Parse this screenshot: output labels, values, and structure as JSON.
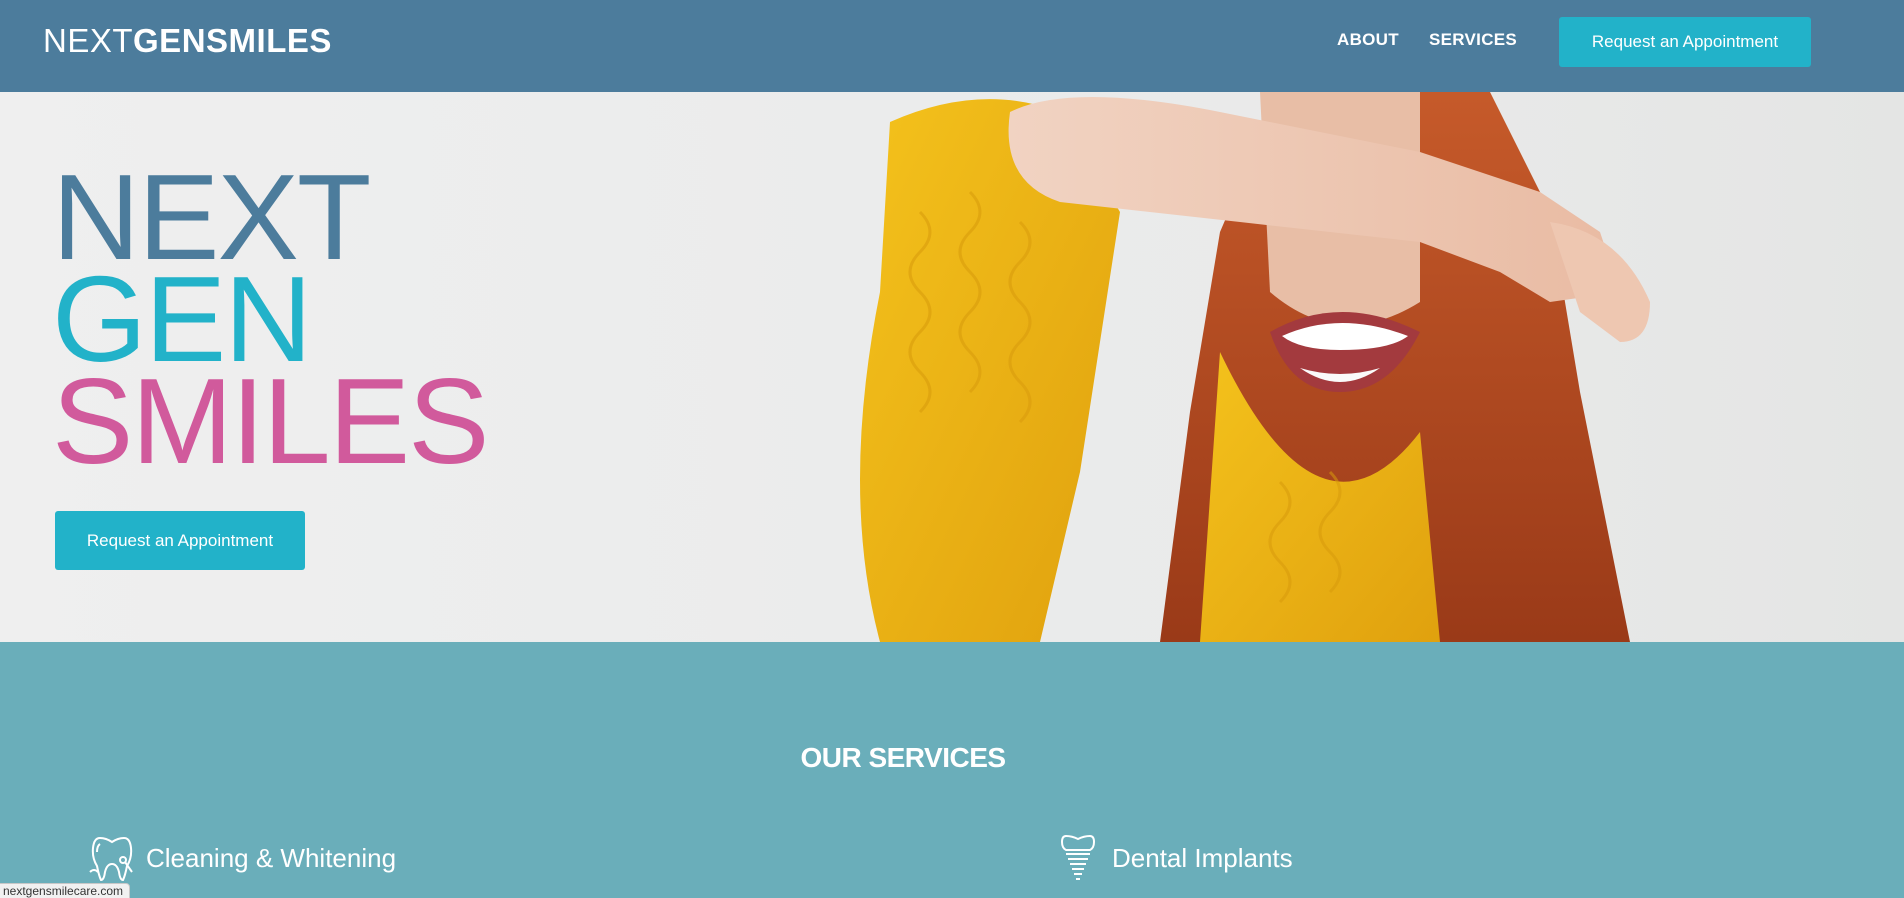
{
  "header": {
    "logo_next": "NEXT",
    "logo_gen": "GEN",
    "logo_smiles": "SMILES",
    "nav": [
      "ABOUT",
      "SERVICES"
    ],
    "cta_label": "Request an Appointment"
  },
  "hero": {
    "title_line1": "NEXT",
    "title_line2": "GEN",
    "title_line3": "SMILES",
    "cta_label": "Request an Appointment"
  },
  "services": {
    "title": "OUR SERVICES",
    "items": [
      {
        "label": "Cleaning & Whitening",
        "icon": "tooth-icon"
      },
      {
        "label": "Dental Implants",
        "icon": "implant-icon"
      }
    ]
  },
  "status": {
    "url": "nextgensmilecare.com"
  },
  "colors": {
    "header_bg": "#4c7c9c",
    "accent": "#22b2c9",
    "pink": "#d15a9c",
    "services_bg": "#6aaeba"
  }
}
